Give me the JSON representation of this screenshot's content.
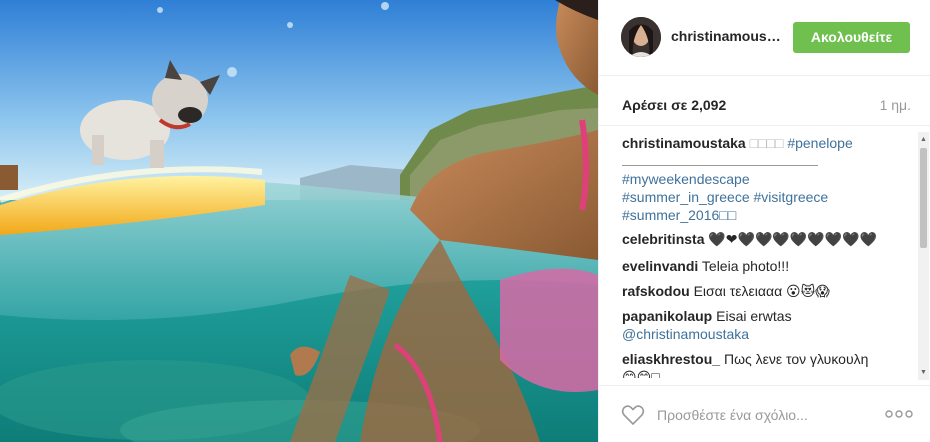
{
  "post": {
    "username": "christinamous…",
    "follow_label": "Ακολουθείτε",
    "likes_label": "Αρέσει σε 2,092",
    "time_label": "1 ημ."
  },
  "caption": {
    "user": "christinamoustaka",
    "glyphs": "□□□□",
    "tag1": "#penelope",
    "line2": "#myweekendescape",
    "line3": "#summer_in_greece #visitgreece",
    "line4": "#summer_2016□□"
  },
  "comments": [
    {
      "user": "celebritinsta",
      "text": "🖤❤🖤🖤🖤🖤🖤🖤🖤🖤"
    },
    {
      "user": "evelinvandi",
      "text": "Teleia photo!!!"
    },
    {
      "user": "rafskodou",
      "text": "Εισαι τελειααα 😮😻😱"
    },
    {
      "user": "papanikolaup",
      "text": "Eisai erwtas",
      "line2": "@christinamoustaka"
    },
    {
      "user": "eliaskhrestou_",
      "text": "Πως λενε τον γλυκουλη",
      "line2": "😊😊□"
    }
  ],
  "footer": {
    "comment_placeholder": "Προσθέστε ένα σχόλιο...",
    "heart_icon": "heart-outline-icon",
    "more_icon": "more-dots-icon"
  },
  "colors": {
    "follow_green": "#70c050",
    "hashtag_blue": "#3f729b"
  }
}
